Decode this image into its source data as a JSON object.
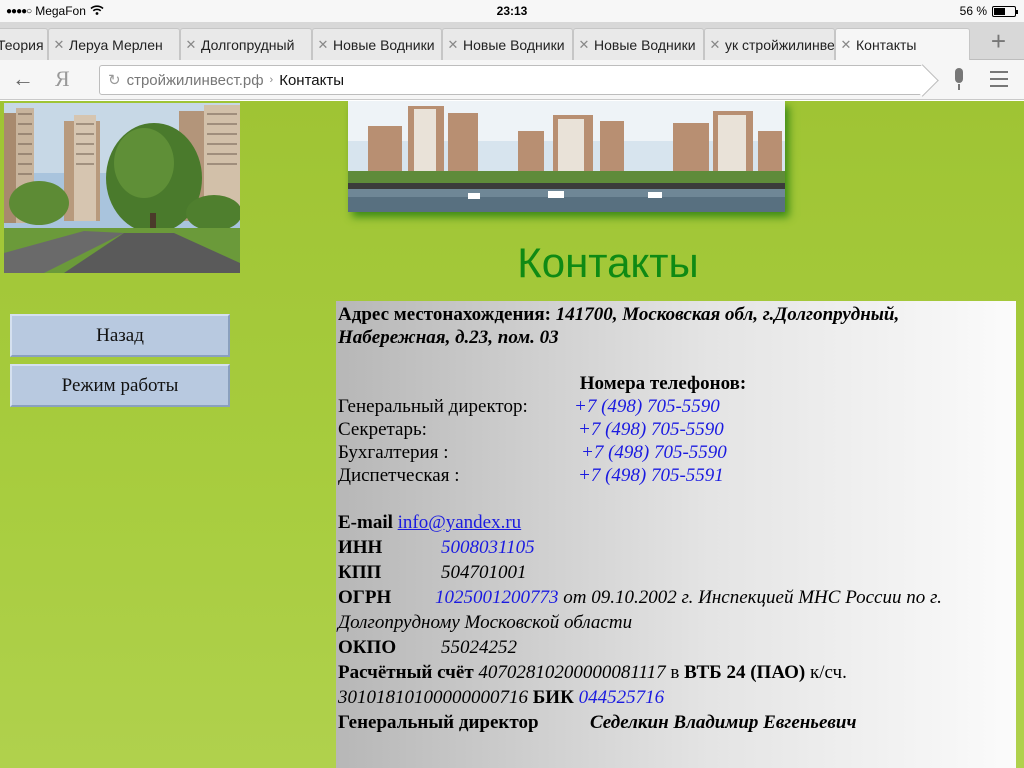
{
  "status": {
    "carrier": "MegaFon",
    "time": "23:13",
    "battery": "56 %",
    "battery_level": 0.56
  },
  "tabs": [
    {
      "title": "Теория",
      "active": false
    },
    {
      "title": "Леруа Мерлен",
      "active": false
    },
    {
      "title": "Долгопрудный",
      "active": false
    },
    {
      "title": "Новые Водники",
      "active": false
    },
    {
      "title": "Новые Водники",
      "active": false
    },
    {
      "title": "Новые Водники",
      "active": false
    },
    {
      "title": "ук стройжилинвест",
      "active": false
    },
    {
      "title": "Контакты",
      "active": true
    }
  ],
  "address": {
    "domain": "стройжилинвест.рф",
    "separator": "›",
    "path": "Контакты",
    "search_logo": "Я"
  },
  "page": {
    "heading": "Контакты",
    "nav": {
      "back": "Назад",
      "hours": "Режим работы"
    },
    "address_label": "Адрес местонахождения:",
    "address_value_1": "141700, Московская обл, г.Долгопрудный,",
    "address_value_2": "Набережная, д.23, пом. 03",
    "phones_title": "Номера телефонов:",
    "phones": [
      {
        "label": "Генеральный директор:",
        "number": "+7 (498) 705-5590"
      },
      {
        "label": "Секретарь:",
        "number": "+7 (498) 705-5590"
      },
      {
        "label": "Бухгалтерия :",
        "number": "+7 (498) 705-5590"
      },
      {
        "label": "Диспетческая :",
        "number": "+7 (498) 705-5591"
      }
    ],
    "email_label": "E-mail",
    "email": "info@yandex.ru",
    "inn_label": "ИНН",
    "inn": "5008031105",
    "kpp_label": "КПП",
    "kpp": "504701001",
    "ogrn_label": "ОГРН",
    "ogrn": "1025001200773",
    "ogrn_rest_1": " от 09.10.2002 г. Инспекцией МНС России по г.",
    "ogrn_rest_2": "Долгопрудному Московской области",
    "okpo_label": "ОКПО",
    "okpo": "55024252",
    "account_label": "Расчётный счёт",
    "account": "40702810200000081117",
    "account_in": "в",
    "bank": "ВТБ 24 (ПАО)",
    "corr_label": "к/сч.",
    "corr": "30101810100000000716",
    "bik_label": "БИК",
    "bik": "044525716",
    "director_label": "Генеральный директор",
    "director": "Седелкин Владимир Евгеньевич"
  },
  "colors": {
    "page_bg": "#a8cd3f",
    "heading": "#0f8a14",
    "link_blue": "#1a1ae0",
    "button_bg": "#b8c9e0"
  }
}
